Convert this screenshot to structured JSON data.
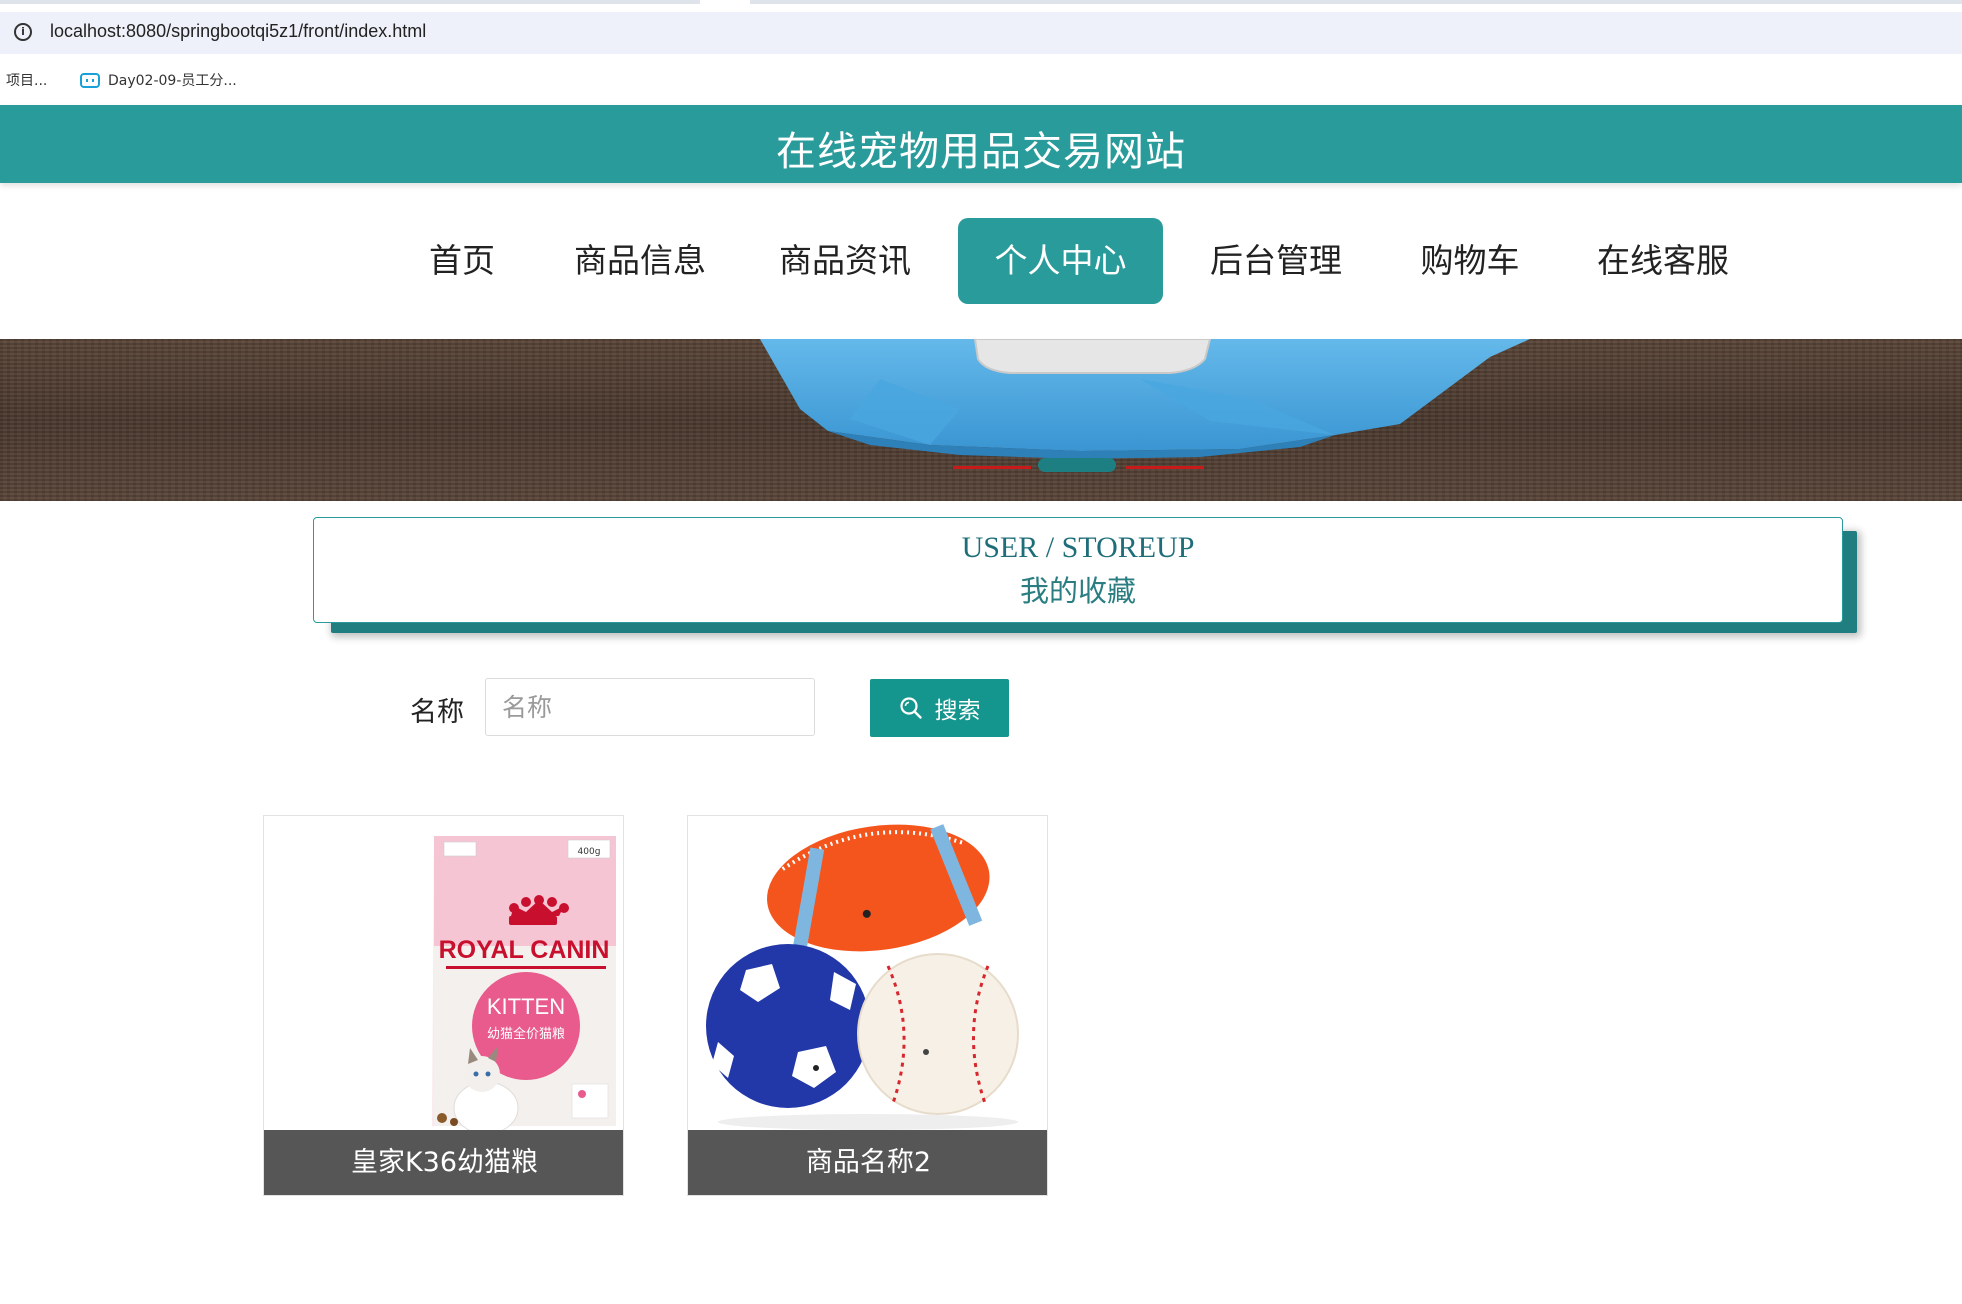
{
  "browser": {
    "url": "localhost:8080/springbootqi5z1/front/index.html",
    "bookmarks": [
      {
        "label": "项目..."
      },
      {
        "label": "Day02-09-员工分..."
      }
    ]
  },
  "header": {
    "site_title": "在线宠物用品交易网站"
  },
  "nav": {
    "items": [
      {
        "label": "首页",
        "active": false
      },
      {
        "label": "商品信息",
        "active": false
      },
      {
        "label": "商品资讯",
        "active": false
      },
      {
        "label": "个人中心",
        "active": true
      },
      {
        "label": "后台管理",
        "active": false
      },
      {
        "label": "购物车",
        "active": false
      },
      {
        "label": "在线客服",
        "active": false
      }
    ]
  },
  "banner": {
    "slide_count": 3,
    "active_slide": 2
  },
  "section": {
    "title_en": "USER / STOREUP",
    "title_cn": "我的收藏"
  },
  "search": {
    "label": "名称",
    "placeholder": "名称",
    "value": "",
    "button_label": "搜索"
  },
  "products": [
    {
      "name": "皇家K36幼猫粮",
      "image": "royal-canin-kitten-food-bag",
      "brand_text": "ROYAL CANIN",
      "product_text": "KITTEN",
      "sub_text": "幼猫全价猫粮",
      "weight": "400g"
    },
    {
      "name": "商品名称2",
      "image": "rubber-pet-toy-balls"
    }
  ],
  "colors": {
    "primary": "#2a9b9b",
    "button": "#14958d",
    "caption_bg": "#565656",
    "dot_inactive": "#c81a1a"
  }
}
